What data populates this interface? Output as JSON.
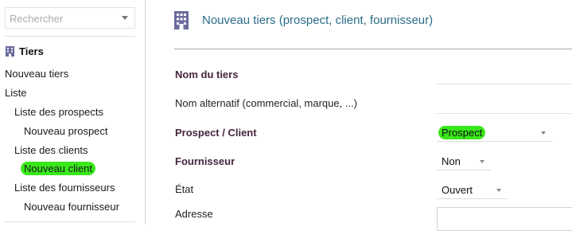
{
  "sidebar": {
    "search_placeholder": "Rechercher",
    "menu_title": "Tiers",
    "items": [
      {
        "label": "Nouveau tiers"
      },
      {
        "label": "Liste"
      },
      {
        "label": "Liste des prospects"
      },
      {
        "label": "Nouveau prospect"
      },
      {
        "label": "Liste des clients"
      },
      {
        "label": "Nouveau client"
      },
      {
        "label": "Liste des fournisseurs"
      },
      {
        "label": "Nouveau fournisseur"
      }
    ]
  },
  "main": {
    "title": "Nouveau tiers (prospect, client, fournisseur)",
    "form": {
      "name_label": "Nom du tiers",
      "alt_name_label": "Nom alternatif (commercial, marque, ...)",
      "prospect_client_label": "Prospect / Client",
      "prospect_client_value": "Prospect",
      "supplier_label": "Fournisseur",
      "supplier_value": "Non",
      "state_label": "État",
      "state_value": "Ouvert",
      "address_label": "Adresse"
    }
  },
  "colors": {
    "accent": "#2b6c8a",
    "highlight": "#39e81b",
    "required_label": "#44253e"
  }
}
